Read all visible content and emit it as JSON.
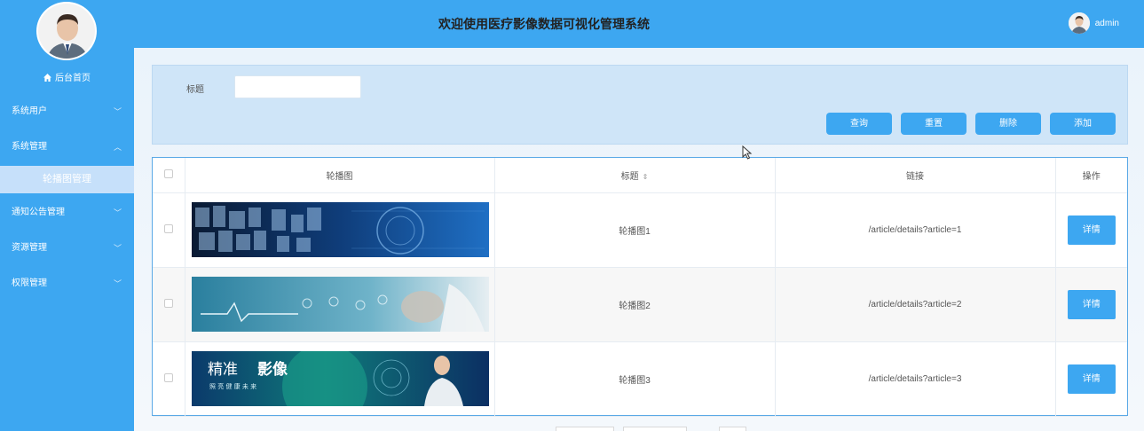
{
  "app": {
    "title": "欢迎使用医疗影像数据可视化管理系统",
    "user": "admin"
  },
  "sidebar": {
    "home": "后台首页",
    "items": [
      {
        "label": "系统用户",
        "chevron": "﹀"
      },
      {
        "label": "系统管理",
        "chevron": "︿"
      },
      {
        "label": "通知公告管理",
        "chevron": "﹀"
      },
      {
        "label": "资源管理",
        "chevron": "﹀"
      },
      {
        "label": "权限管理",
        "chevron": "﹀"
      }
    ],
    "active_sub": "轮播图管理"
  },
  "search": {
    "label": "标题",
    "value": "",
    "buttons": {
      "query": "查询",
      "reset": "重置",
      "delete": "删除",
      "add": "添加"
    }
  },
  "table": {
    "headers": {
      "image": "轮播图",
      "title": "标题",
      "link": "链接",
      "actions": "操作"
    },
    "rows": [
      {
        "title": "轮播图1",
        "link": "/article/details?article=1",
        "action": "详情"
      },
      {
        "title": "轮播图2",
        "link": "/article/details?article=2",
        "action": "详情"
      },
      {
        "title": "轮播图3",
        "link": "/article/details?article=3",
        "action": "详情"
      }
    ]
  },
  "banner3": {
    "big_text_1": "精准",
    "big_text_2": "影像",
    "small_text": "照 亮 健 康 未 来"
  },
  "colors": {
    "primary": "#3da7f1",
    "panel": "#cfe5f8",
    "active_sub": "#c6e0fa"
  }
}
